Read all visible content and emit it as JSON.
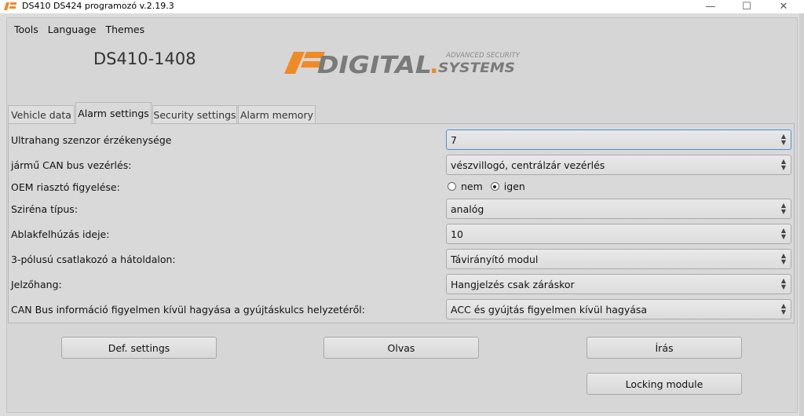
{
  "window": {
    "title": "DS410 DS424 programozó v.2.19.3",
    "minimize_glyph": "—",
    "maximize_glyph": "☐",
    "close_glyph": "✕"
  },
  "menu": [
    "Tools",
    "Language",
    "Themes"
  ],
  "device_title": "DS410-1408",
  "logo": {
    "main": "DIGITAL",
    "dot": ".",
    "sub": "SYSTEMS",
    "tagline": "ADVANCED SECURITY",
    "accent_color": "#f08a24",
    "gray_color": "#7a7a7a"
  },
  "tabs": [
    {
      "label": "Vehicle data",
      "active": false
    },
    {
      "label": "Alarm settings",
      "active": true
    },
    {
      "label": "Security settings",
      "active": false
    },
    {
      "label": "Alarm memory",
      "active": false
    }
  ],
  "settings": [
    {
      "label": "Ultrahang szenzor érzékenysége",
      "type": "combo",
      "value": "7",
      "focused": true
    },
    {
      "label": "jármű CAN bus vezérlés:",
      "type": "combo",
      "value": "vészvillogó, centrálzár vezérlés"
    },
    {
      "label": "OEM riasztó figyelése:",
      "type": "radio",
      "options": [
        "nem",
        "igen"
      ],
      "selected": "igen"
    },
    {
      "label": "Sziréna típus:",
      "type": "combo",
      "value": "analóg"
    },
    {
      "label": "Ablakfelhúzás ideje:",
      "type": "combo",
      "value": "10"
    },
    {
      "label": "3-pólusú csatlakozó a hátoldalon:",
      "type": "combo",
      "value": "Távirányító modul"
    },
    {
      "label": "Jelzőhang:",
      "type": "combo",
      "value": "Hangjelzés csak záráskor"
    },
    {
      "label": "CAN Bus információ figyelmen kívül hagyása a gyújtáskulcs helyzetéről:",
      "type": "combo",
      "value": "ACC és gyújtás figyelmen kívül hagyása"
    }
  ],
  "buttons": {
    "def_settings": "Def. settings",
    "read": "Olvas",
    "write": "Írás",
    "locking_module": "Locking module"
  },
  "combo_arrows": {
    "up": "▲",
    "down": "▼"
  }
}
